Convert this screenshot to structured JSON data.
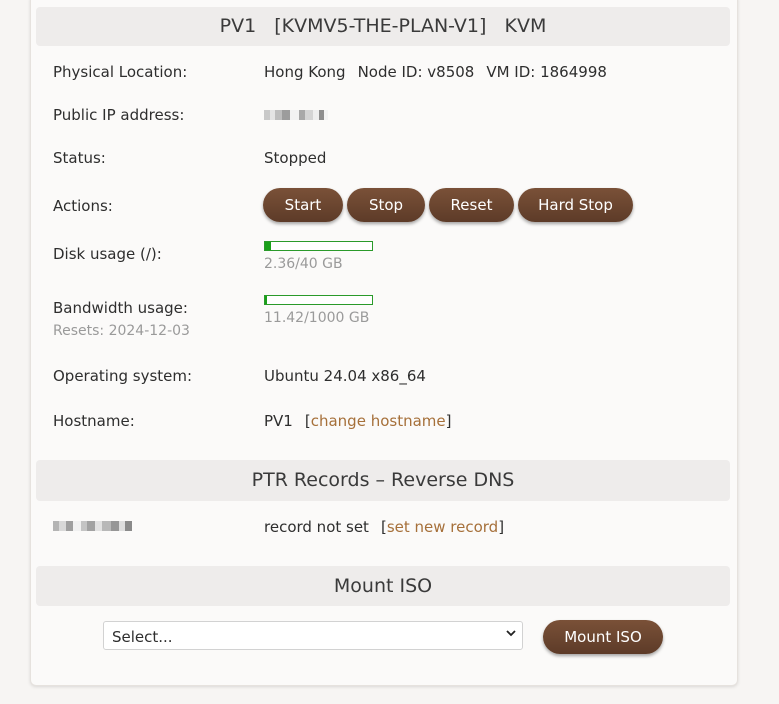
{
  "vm": {
    "title": "PV1   [KVMV5-THE-PLAN-V1]   KVM",
    "location_label": "Physical Location:",
    "location_value": "Hong Kong",
    "node_id": "Node ID: v8508",
    "vm_id": "VM ID: 1864998",
    "ip_label": "Public IP address:",
    "status_label": "Status:",
    "status_value": "Stopped",
    "actions_label": "Actions:",
    "actions": [
      "Start",
      "Stop",
      "Reset",
      "Hard Stop"
    ],
    "disk_label": "Disk usage (/):",
    "disk_text": "2.36/40 GB",
    "disk_fraction": 0.059,
    "bw_label": "Bandwidth usage:",
    "bw_resets": "Resets: 2024-12-03",
    "bw_text": "11.42/1000 GB",
    "bw_fraction": 0.0114,
    "os_label": "Operating system:",
    "os_value": "Ubuntu 24.04 x86_64",
    "hostname_label": "Hostname:",
    "hostname_value": "PV1",
    "change_hostname": "change hostname"
  },
  "ptr": {
    "title": "PTR Records – Reverse DNS",
    "record_status": "record not set",
    "set_record": "set new record"
  },
  "iso": {
    "title": "Mount ISO",
    "select_value": "Select...",
    "mount_button": "Mount ISO"
  },
  "colors": {
    "button": "#6a4530",
    "link": "#a6703a",
    "bar": "#19a019",
    "header_bg": "#eeeceb"
  }
}
